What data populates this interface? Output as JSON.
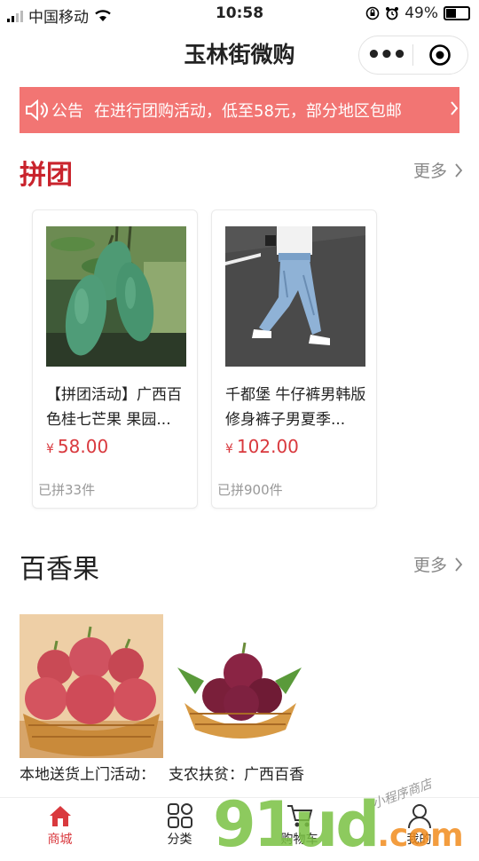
{
  "status_bar": {
    "carrier": "中国移动",
    "time": "10:58",
    "battery": "49%",
    "battery_level": 0.49
  },
  "nav": {
    "title": "玉林街微购"
  },
  "notice": {
    "label": "公告",
    "text": "在进行团购活动，低至58元，部分地区包邮"
  },
  "group_section": {
    "title": "拼团",
    "more": "更多",
    "items": [
      {
        "name": "【拼团活动】广西百色桂七芒果 果园...",
        "currency": "¥",
        "price": "58.00",
        "sold": "已拼33件"
      },
      {
        "name": "千都堡 牛仔裤男韩版修身裤子男夏季...",
        "currency": "¥",
        "price": "102.00",
        "sold": "已拼900件"
      }
    ]
  },
  "fruit_section": {
    "title": "百香果",
    "more": "更多",
    "items": [
      {
        "name": "本地送货上门活动："
      },
      {
        "name": "支农扶贫：广西百香"
      }
    ]
  },
  "tabbar": {
    "items": [
      {
        "label": "商城"
      },
      {
        "label": "分类"
      },
      {
        "label": "购物车"
      },
      {
        "label": "我的"
      }
    ]
  },
  "watermark": {
    "main": "91ud",
    "domain": ".com",
    "sub": "小程序商店"
  },
  "colors": {
    "accent": "#d9393e",
    "notice_bg": "#f27573"
  }
}
